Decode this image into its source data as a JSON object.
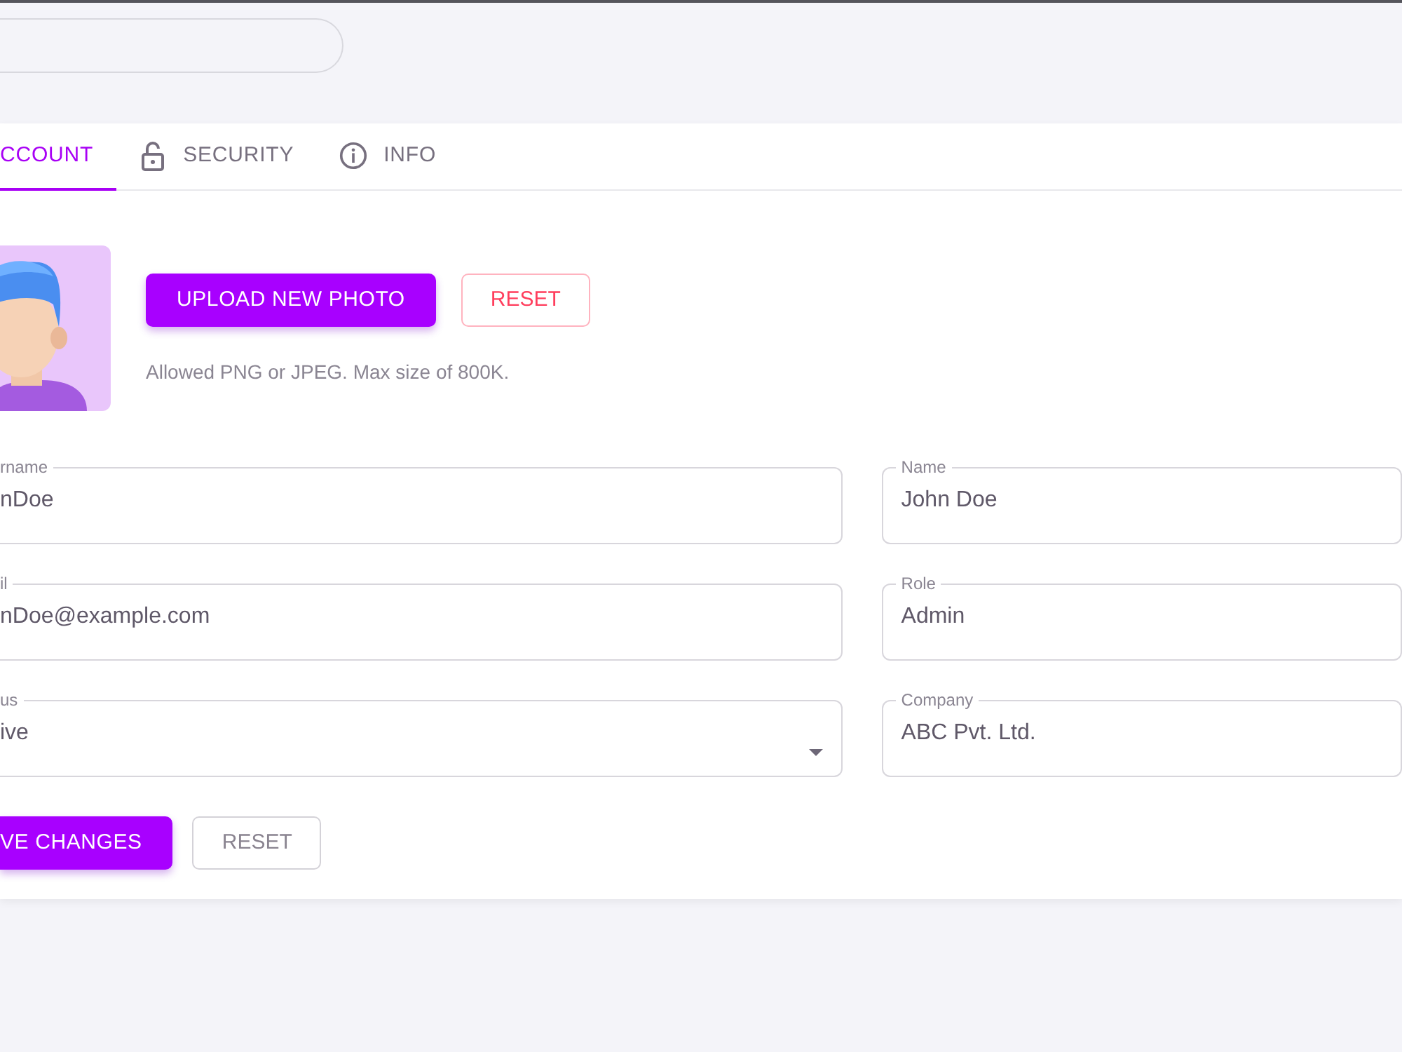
{
  "tabs": [
    {
      "label": "CCOUNT",
      "selected": true
    },
    {
      "label": "SECURITY",
      "selected": false
    },
    {
      "label": "INFO",
      "selected": false
    }
  ],
  "photo": {
    "upload_button": "UPLOAD NEW PHOTO",
    "reset_button": "RESET",
    "hint": "Allowed PNG or JPEG. Max size of 800K."
  },
  "form": {
    "columns": [
      {
        "fields": [
          {
            "label": "rname",
            "value": "nDoe",
            "kind": "text"
          },
          {
            "label": "il",
            "value": "nDoe@example.com",
            "kind": "text"
          },
          {
            "label": "us",
            "value": "ive",
            "kind": "select"
          }
        ]
      },
      {
        "fields": [
          {
            "label": "Name",
            "value": "John Doe",
            "kind": "text"
          },
          {
            "label": "Role",
            "value": "Admin",
            "kind": "text"
          },
          {
            "label": "Company",
            "value": "ABC Pvt. Ltd.",
            "kind": "text"
          }
        ]
      }
    ]
  },
  "actions": {
    "save_button": "VE CHANGES",
    "reset_button": "RESET"
  }
}
